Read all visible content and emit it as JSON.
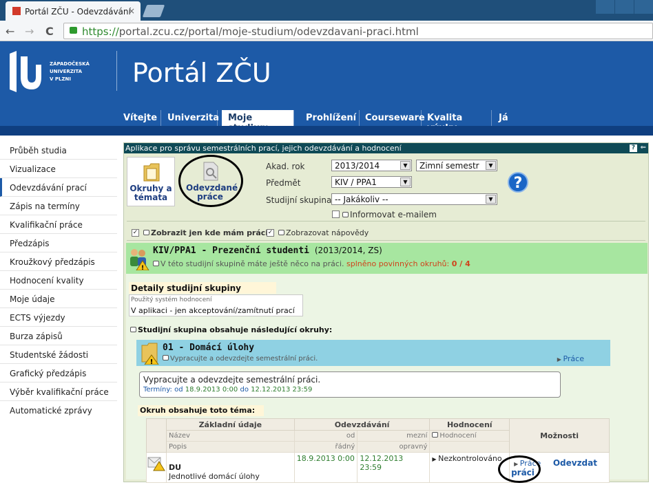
{
  "browser": {
    "tab_title": "Portál ZČU - Odevzdávání",
    "tab_close": "×",
    "back": "←",
    "forward": "→",
    "reload": "C",
    "url_protocol": "https://",
    "url_rest": "portal.zcu.cz/portal/moje-studium/odevzdavani-praci.html"
  },
  "header": {
    "logo_lines": [
      "ZÁPADOČESKÁ",
      "UNIVERZITA",
      "V PLZNI"
    ],
    "title": "Portál ZČU"
  },
  "menu": [
    "Vítejte",
    "Univerzita",
    "Moje studium",
    "Prohlížení",
    "Courseware",
    "Kvalita výuky",
    "Já"
  ],
  "menu_active": "Moje studium",
  "sidebar": [
    "Průběh studia",
    "Vizualizace",
    "Odevzdávání prací",
    "Zápis na termíny",
    "Kvalifikační práce",
    "Předzápis",
    "Kroužkový předzápis",
    "Hodnocení kvality",
    "Moje údaje",
    "ECTS výjezdy",
    "Burza zápisů",
    "Studentské žádosti",
    "Grafický předzápis",
    "Výběr kvalifikační práce",
    "Automatické zprávy"
  ],
  "sidebar_active": "Odevzdávání prací",
  "app": {
    "title": "Aplikace pro správu semestrálních prací, jejich odevzdávání a hodnocení",
    "help_small": "?",
    "back_small": "⇐",
    "btn_topics": "Okruhy a témata",
    "btn_submitted": "Odevzdané práce",
    "labels": {
      "year": "Akad. rok",
      "subject": "Předmět",
      "group": "Studijní skupina"
    },
    "year_value": "2013/2014",
    "semester_value": "Zimní semestr",
    "subject_value": "KIV / PPA1",
    "group_value": "-- Jakákoliv --",
    "inform_email": "Informovat e-mailem",
    "chk_only_work": "Zobrazit jen kde mám práci",
    "chk_hints": "Zobrazovat nápovědy",
    "help_big": "?"
  },
  "group": {
    "code_title": "KIV/PPA1 - Prezenční studenti",
    "year_info": "(2013/2014, ZS)",
    "note": "V této studijní skupině máte ještě něco na práci.",
    "required_label": "splněno povinných okruhů:",
    "required_value": "0 / 4",
    "details_head": "Detaily studijní skupiny",
    "eval_label": "Použitý systém hodnocení",
    "eval_value": "V aplikaci - jen akceptování/zamítnutí prací",
    "contains": "Studijní skupina obsahuje následující okruhy:"
  },
  "topic": {
    "title": "01 - Domácí úlohy",
    "note": "Vypracujte a odevzdejte semestrální práci.",
    "prace_link": "Práce",
    "desc": "Vypracujte a odevzdejte semestrální práci.",
    "terms_label": "Termíny: od",
    "terms_from": "18.9.2013 0:00",
    "terms_to_label": "do",
    "terms_to": "12.12.2013 23:59",
    "contains_topic": "Okruh obsahuje toto téma:"
  },
  "table": {
    "h_basic": "Základní údaje",
    "h_submission": "Odevzdávání",
    "h_eval": "Hodnocení",
    "h_options": "Možnosti",
    "s_name": "Název",
    "s_from": "od",
    "s_max": "mezní",
    "s_eval": "Hodnocení",
    "s_desc": "Popis",
    "s_regular": "řádný",
    "s_corr": "opravný",
    "row": {
      "name": "DU",
      "desc": "Jednotlivé domácí úlohy",
      "from": "18.9.2013 0:00",
      "max": "12.12.2013 23:59",
      "eval": "Nezkontrolováno",
      "prace": "Práce",
      "submit": "Odevzdat práci"
    }
  }
}
